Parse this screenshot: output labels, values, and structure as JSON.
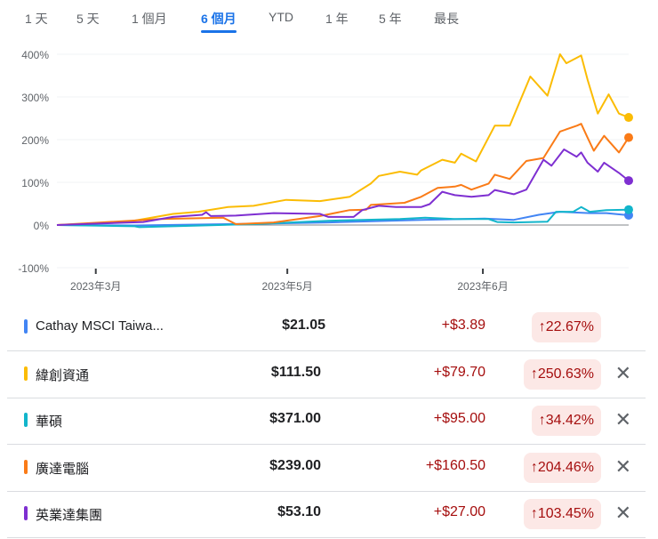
{
  "tabs": [
    {
      "label": "1 天"
    },
    {
      "label": "5 天"
    },
    {
      "label": "1 個月"
    },
    {
      "label": "6 個月",
      "active": true
    },
    {
      "label": "YTD"
    },
    {
      "label": "1 年"
    },
    {
      "label": "5 年"
    },
    {
      "label": "最長"
    }
  ],
  "chart_data": {
    "type": "line",
    "ylabel": "",
    "xlabel": "",
    "ylim": [
      -100,
      400
    ],
    "yticks": [
      "400%",
      "300%",
      "200%",
      "100%",
      "0%",
      "-100%"
    ],
    "ytick_values": [
      400,
      300,
      200,
      100,
      0,
      -100
    ],
    "xticks": [
      {
        "label": "2023年3月",
        "t": 6.8
      },
      {
        "label": "2023年5月",
        "t": 40.3
      },
      {
        "label": "2023年6月",
        "t": 74.5
      }
    ],
    "x_range": [
      0,
      100
    ],
    "series": [
      {
        "name": "Cathay MSCI Taiwan",
        "color": "#4285f4",
        "points": [
          [
            0,
            0
          ],
          [
            13.6,
            -1
          ],
          [
            34.2,
            3
          ],
          [
            47.5,
            6
          ],
          [
            63.7,
            12
          ],
          [
            74.8,
            15
          ],
          [
            79.9,
            12
          ],
          [
            84.3,
            24
          ],
          [
            88,
            31
          ],
          [
            93.2,
            28
          ],
          [
            96.1,
            28
          ],
          [
            100,
            23
          ]
        ]
      },
      {
        "name": "緯創資通",
        "color": "#fbbc04",
        "points": [
          [
            0,
            0
          ],
          [
            12.2,
            7
          ],
          [
            20.3,
            26
          ],
          [
            24.7,
            31
          ],
          [
            29.9,
            42
          ],
          [
            34.4,
            45
          ],
          [
            40.1,
            59
          ],
          [
            46,
            56
          ],
          [
            51.2,
            66
          ],
          [
            54.9,
            97
          ],
          [
            56.3,
            115
          ],
          [
            60,
            125
          ],
          [
            63,
            118
          ],
          [
            63.7,
            128
          ],
          [
            67.4,
            153
          ],
          [
            69.6,
            146
          ],
          [
            70.7,
            167
          ],
          [
            73.3,
            149
          ],
          [
            76.6,
            233
          ],
          [
            79.2,
            233
          ],
          [
            82.8,
            348
          ],
          [
            85.8,
            303
          ],
          [
            88,
            400
          ],
          [
            89.1,
            379
          ],
          [
            91.7,
            397
          ],
          [
            92.8,
            341
          ],
          [
            94.6,
            261
          ],
          [
            96.5,
            306
          ],
          [
            98.3,
            261
          ],
          [
            100,
            252
          ]
        ]
      },
      {
        "name": "華碩",
        "color": "#12b5cb",
        "points": [
          [
            0,
            0
          ],
          [
            13.6,
            -3
          ],
          [
            14.4,
            -5
          ],
          [
            34.2,
            2
          ],
          [
            47.5,
            10
          ],
          [
            60,
            14
          ],
          [
            64.4,
            17
          ],
          [
            69.6,
            14
          ],
          [
            75.5,
            14
          ],
          [
            77,
            7
          ],
          [
            79.9,
            6
          ],
          [
            85.8,
            8
          ],
          [
            87.3,
            31
          ],
          [
            90.3,
            31
          ],
          [
            91.7,
            42
          ],
          [
            93.2,
            31
          ],
          [
            96.1,
            35
          ],
          [
            100,
            36
          ]
        ]
      },
      {
        "name": "廣達電腦",
        "color": "#fa7b17",
        "points": [
          [
            0,
            0
          ],
          [
            18,
            14
          ],
          [
            29.1,
            17
          ],
          [
            31.3,
            2
          ],
          [
            37.9,
            6
          ],
          [
            46,
            21
          ],
          [
            51.2,
            35
          ],
          [
            54.1,
            36
          ],
          [
            54.9,
            47
          ],
          [
            60.8,
            52
          ],
          [
            63.7,
            66
          ],
          [
            66.6,
            87
          ],
          [
            69.6,
            90
          ],
          [
            70.7,
            94
          ],
          [
            72.5,
            83
          ],
          [
            75.5,
            97
          ],
          [
            76.6,
            118
          ],
          [
            79.2,
            108
          ],
          [
            82.1,
            150
          ],
          [
            85.1,
            157
          ],
          [
            88,
            219
          ],
          [
            91,
            233
          ],
          [
            91.7,
            237
          ],
          [
            92.8,
            205
          ],
          [
            93.9,
            174
          ],
          [
            95.7,
            209
          ],
          [
            98.3,
            170
          ],
          [
            100,
            205
          ]
        ]
      },
      {
        "name": "英業達集團",
        "color": "#7e2fd1",
        "points": [
          [
            0,
            0
          ],
          [
            15.1,
            7
          ],
          [
            20.3,
            19
          ],
          [
            25.4,
            24
          ],
          [
            26.1,
            30
          ],
          [
            26.9,
            21
          ],
          [
            31.3,
            22
          ],
          [
            37.9,
            28
          ],
          [
            46,
            26
          ],
          [
            47.5,
            19
          ],
          [
            51.9,
            19
          ],
          [
            53.4,
            35
          ],
          [
            56.3,
            45
          ],
          [
            59.3,
            42
          ],
          [
            63.7,
            42
          ],
          [
            65.2,
            49
          ],
          [
            67.4,
            78
          ],
          [
            69.6,
            70
          ],
          [
            72.5,
            66
          ],
          [
            75.5,
            70
          ],
          [
            76.6,
            82
          ],
          [
            79.9,
            72
          ],
          [
            82.1,
            83
          ],
          [
            85.1,
            153
          ],
          [
            86.5,
            139
          ],
          [
            88.7,
            177
          ],
          [
            90.9,
            160
          ],
          [
            91.7,
            170
          ],
          [
            92.8,
            146
          ],
          [
            94.6,
            125
          ],
          [
            95.7,
            146
          ],
          [
            98.3,
            122
          ],
          [
            100,
            104
          ]
        ]
      }
    ]
  },
  "rows": [
    {
      "color": "#4285f4",
      "name": "Cathay MSCI Taiwa...",
      "price": "$21.05",
      "change": "+$3.89",
      "percent": "22.67%",
      "removable": false
    },
    {
      "color": "#fbbc04",
      "name": "緯創資通",
      "price": "$111.50",
      "change": "+$79.70",
      "percent": "250.63%",
      "removable": true
    },
    {
      "color": "#12b5cb",
      "name": "華碩",
      "price": "$371.00",
      "change": "+$95.00",
      "percent": "34.42%",
      "removable": true
    },
    {
      "color": "#fa7b17",
      "name": "廣達電腦",
      "price": "$239.00",
      "change": "+$160.50",
      "percent": "204.46%",
      "removable": true
    },
    {
      "color": "#7e2fd1",
      "name": "英業達集團",
      "price": "$53.10",
      "change": "+$27.00",
      "percent": "103.45%",
      "removable": true
    }
  ],
  "icons": {
    "up_arrow": "↑",
    "close": "✕"
  }
}
